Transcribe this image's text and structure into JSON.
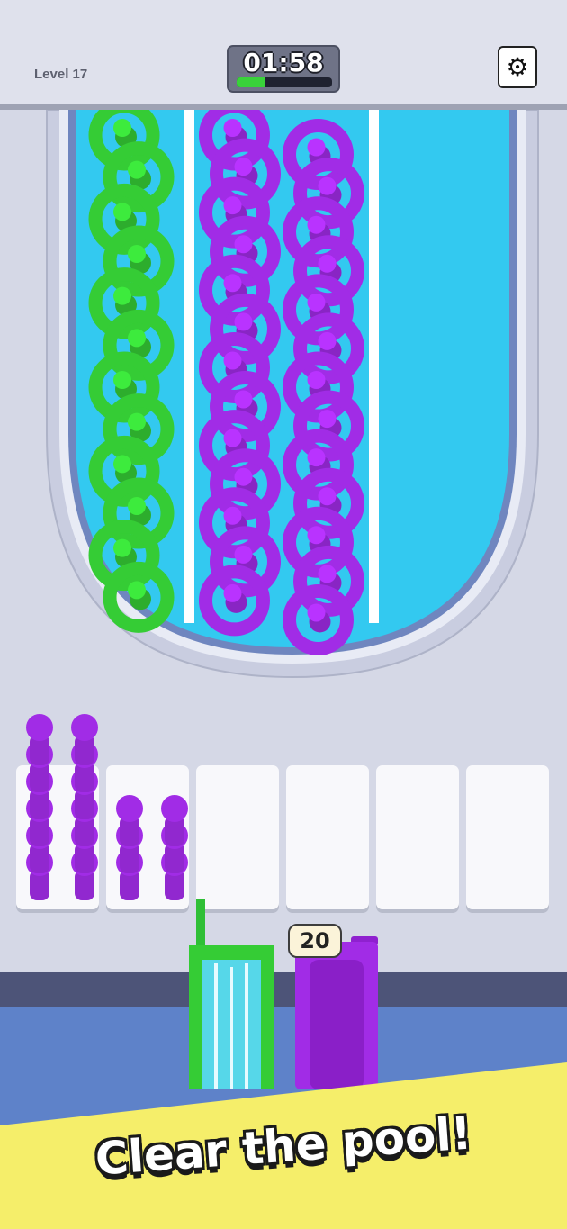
{
  "hud": {
    "level_label": "Level 17",
    "timer_text": "01:58",
    "timer_progress": 0.3,
    "settings_icon": "gear-icon"
  },
  "colors": {
    "green": "#35cc35",
    "purple": "#a12ce6",
    "water": "#33c9f0",
    "banner": "#f5ee6a"
  },
  "pool": {
    "lanes": [
      {
        "color": "green",
        "rings": 12
      },
      {
        "color": "purple",
        "rings": 26
      },
      {
        "color": "empty",
        "rings": 0
      }
    ]
  },
  "slots": [
    {
      "stacks": [
        6,
        6
      ]
    },
    {
      "stacks": [
        3,
        3
      ]
    },
    {
      "stacks": []
    },
    {
      "stacks": []
    },
    {
      "stacks": []
    },
    {
      "stacks": []
    }
  ],
  "slides": {
    "purple_count": "20"
  },
  "banner": {
    "text": "Clear the pool!"
  }
}
